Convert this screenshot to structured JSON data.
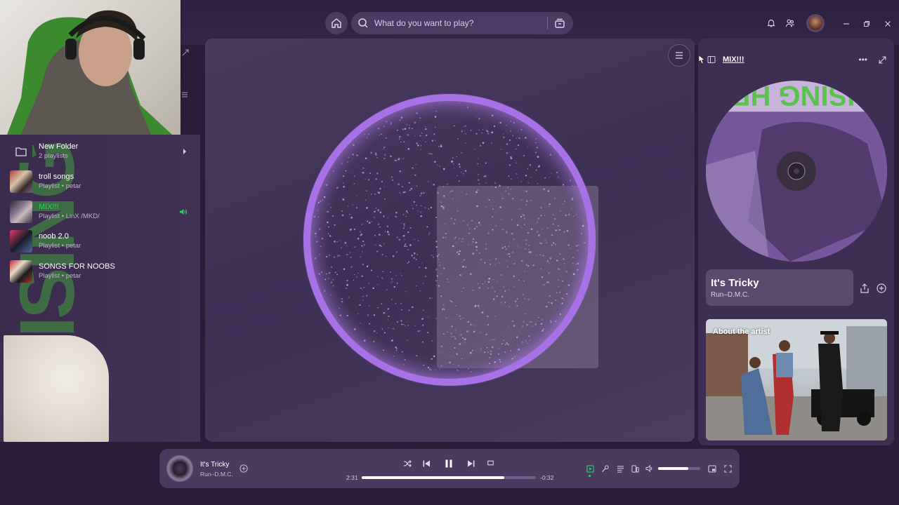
{
  "search": {
    "placeholder": "What do you want to play?"
  },
  "window_controls": [
    "minimize",
    "maximize",
    "close"
  ],
  "library": {
    "items": [
      {
        "title": "New Folder",
        "subtitle": "2 playlists",
        "type": "folder"
      },
      {
        "title": "troll songs",
        "subtitle": "Playlist • petar"
      },
      {
        "title": "MIX!!!",
        "subtitle": "Playlist • LinX /MKD/",
        "playing": true
      },
      {
        "title": "noob 2.0",
        "subtitle": "Playlist • petar"
      },
      {
        "title": "SONGS FOR NOOBS",
        "subtitle": "Playlist • petar"
      }
    ]
  },
  "right_panel": {
    "title": "MIX!!!",
    "album_text": "RAISING HELL",
    "track_title": "It's Tricky",
    "track_artist": "Run–D.M.C.",
    "about_label": "About the artist"
  },
  "player": {
    "track_title": "It's Tricky",
    "track_artist": "Run–D.M.C.",
    "elapsed": "2:31",
    "remaining": "-0:32",
    "progress": 0.82,
    "volume": 0.72
  },
  "colors": {
    "accent_green": "#1ed760",
    "accent_purple": "#9d6bd8",
    "bg": "#2a1d3a"
  },
  "icons": {
    "home": "home-icon",
    "search": "search-icon",
    "browse": "browse-icon",
    "bell": "bell-icon",
    "friends": "friends-icon"
  }
}
